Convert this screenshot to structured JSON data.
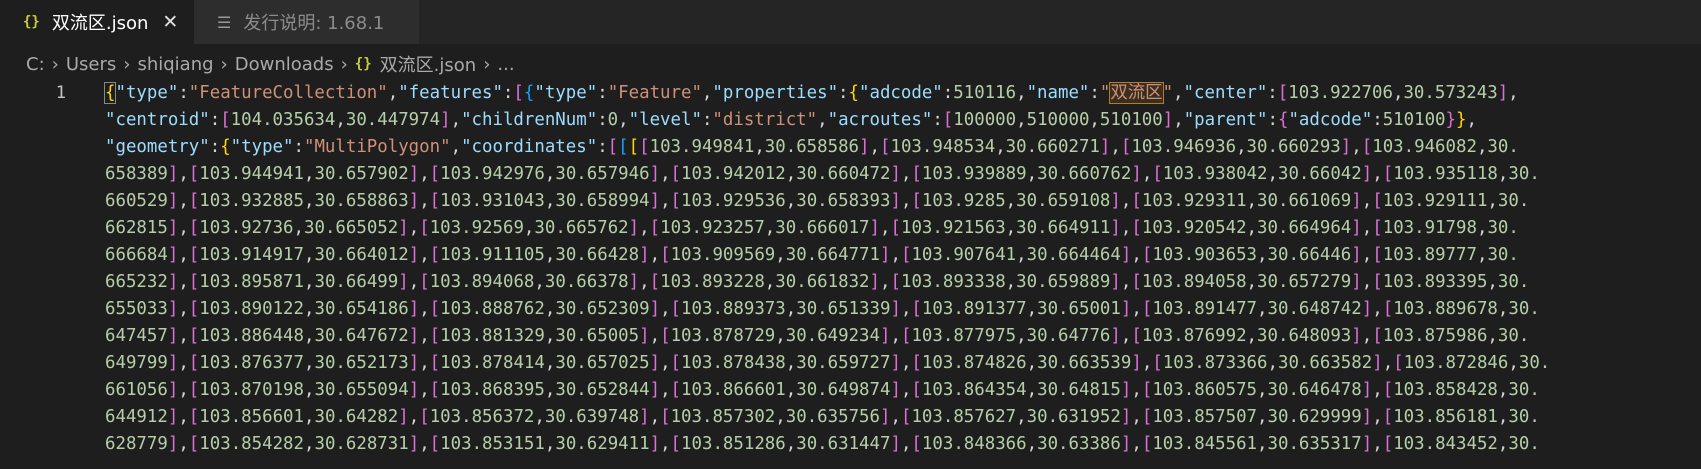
{
  "tabs": [
    {
      "label": "双流区.json",
      "icon": "json-braces-icon",
      "active": true,
      "close": "✕"
    },
    {
      "label": "发行说明: 1.68.1",
      "icon": "document-icon",
      "active": false
    }
  ],
  "breadcrumb": {
    "items": [
      "C:",
      "Users",
      "shiqiang",
      "Downloads",
      "双流区.json",
      "..."
    ],
    "separator": "›"
  },
  "editor": {
    "line_number": "1",
    "lines": [
      "{\"type\":\"FeatureCollection\",\"features\":[{\"type\":\"Feature\",\"properties\":{\"adcode\":510116,\"name\":\"双流区\",\"center\":[103.922706,30.573243],",
      "\"centroid\":[104.035634,30.447974],\"childrenNum\":0,\"level\":\"district\",\"acroutes\":[100000,510000,510100],\"parent\":{\"adcode\":510100}},",
      "\"geometry\":{\"type\":\"MultiPolygon\",\"coordinates\":[[[[103.949841,30.658586],[103.948534,30.660271],[103.946936,30.660293],[103.946082,30.",
      "658389],[103.944941,30.657902],[103.942976,30.657946],[103.942012,30.660472],[103.939889,30.660762],[103.938042,30.66042],[103.935118,30.",
      "660529],[103.932885,30.658863],[103.931043,30.658994],[103.929536,30.658393],[103.9285,30.659108],[103.929311,30.661069],[103.929111,30.",
      "662815],[103.92736,30.665052],[103.92569,30.665762],[103.923257,30.666017],[103.921563,30.664911],[103.920542,30.664964],[103.91798,30.",
      "666684],[103.914917,30.664012],[103.911105,30.66428],[103.909569,30.664771],[103.907641,30.664464],[103.903653,30.66446],[103.89777,30.",
      "665232],[103.895871,30.66499],[103.894068,30.66378],[103.893228,30.661832],[103.893338,30.659889],[103.894058,30.657279],[103.893395,30.",
      "655033],[103.890122,30.654186],[103.888762,30.652309],[103.889373,30.651339],[103.891377,30.65001],[103.891477,30.648742],[103.889678,30.",
      "647457],[103.886448,30.647672],[103.881329,30.65005],[103.878729,30.649234],[103.877975,30.64776],[103.876992,30.648093],[103.875986,30.",
      "649799],[103.876377,30.652173],[103.878414,30.657025],[103.878438,30.659727],[103.874826,30.663539],[103.873366,30.663582],[103.872846,30.",
      "661056],[103.870198,30.655094],[103.868395,30.652844],[103.866601,30.649874],[103.864354,30.64815],[103.860575,30.646478],[103.858428,30.",
      "644912],[103.856601,30.64282],[103.856372,30.639748],[103.857302,30.635756],[103.857627,30.631952],[103.857507,30.629999],[103.856181,30.",
      "628779],[103.854282,30.628731],[103.853151,30.629411],[103.851286,30.631447],[103.848366,30.63386],[103.845561,30.635317],[103.843452,30."
    ]
  },
  "colors": {
    "key": "#9cdcfe",
    "string": "#ce9178",
    "number": "#b5cea8",
    "bracket_level1": "#ffd700",
    "bracket_level2": "#da70d6",
    "bracket_level3": "#179fff",
    "background": "#1e1e1e"
  }
}
